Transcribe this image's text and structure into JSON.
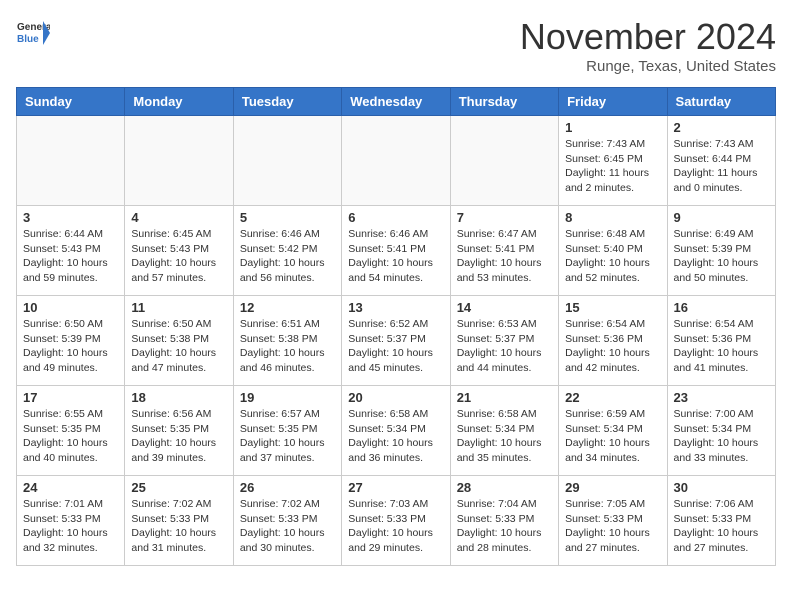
{
  "header": {
    "logo_general": "General",
    "logo_blue": "Blue",
    "month_title": "November 2024",
    "location": "Runge, Texas, United States"
  },
  "days_of_week": [
    "Sunday",
    "Monday",
    "Tuesday",
    "Wednesday",
    "Thursday",
    "Friday",
    "Saturday"
  ],
  "weeks": [
    [
      {
        "day": "",
        "info": ""
      },
      {
        "day": "",
        "info": ""
      },
      {
        "day": "",
        "info": ""
      },
      {
        "day": "",
        "info": ""
      },
      {
        "day": "",
        "info": ""
      },
      {
        "day": "1",
        "info": "Sunrise: 7:43 AM\nSunset: 6:45 PM\nDaylight: 11 hours and 2 minutes."
      },
      {
        "day": "2",
        "info": "Sunrise: 7:43 AM\nSunset: 6:44 PM\nDaylight: 11 hours and 0 minutes."
      }
    ],
    [
      {
        "day": "3",
        "info": "Sunrise: 6:44 AM\nSunset: 5:43 PM\nDaylight: 10 hours and 59 minutes."
      },
      {
        "day": "4",
        "info": "Sunrise: 6:45 AM\nSunset: 5:43 PM\nDaylight: 10 hours and 57 minutes."
      },
      {
        "day": "5",
        "info": "Sunrise: 6:46 AM\nSunset: 5:42 PM\nDaylight: 10 hours and 56 minutes."
      },
      {
        "day": "6",
        "info": "Sunrise: 6:46 AM\nSunset: 5:41 PM\nDaylight: 10 hours and 54 minutes."
      },
      {
        "day": "7",
        "info": "Sunrise: 6:47 AM\nSunset: 5:41 PM\nDaylight: 10 hours and 53 minutes."
      },
      {
        "day": "8",
        "info": "Sunrise: 6:48 AM\nSunset: 5:40 PM\nDaylight: 10 hours and 52 minutes."
      },
      {
        "day": "9",
        "info": "Sunrise: 6:49 AM\nSunset: 5:39 PM\nDaylight: 10 hours and 50 minutes."
      }
    ],
    [
      {
        "day": "10",
        "info": "Sunrise: 6:50 AM\nSunset: 5:39 PM\nDaylight: 10 hours and 49 minutes."
      },
      {
        "day": "11",
        "info": "Sunrise: 6:50 AM\nSunset: 5:38 PM\nDaylight: 10 hours and 47 minutes."
      },
      {
        "day": "12",
        "info": "Sunrise: 6:51 AM\nSunset: 5:38 PM\nDaylight: 10 hours and 46 minutes."
      },
      {
        "day": "13",
        "info": "Sunrise: 6:52 AM\nSunset: 5:37 PM\nDaylight: 10 hours and 45 minutes."
      },
      {
        "day": "14",
        "info": "Sunrise: 6:53 AM\nSunset: 5:37 PM\nDaylight: 10 hours and 44 minutes."
      },
      {
        "day": "15",
        "info": "Sunrise: 6:54 AM\nSunset: 5:36 PM\nDaylight: 10 hours and 42 minutes."
      },
      {
        "day": "16",
        "info": "Sunrise: 6:54 AM\nSunset: 5:36 PM\nDaylight: 10 hours and 41 minutes."
      }
    ],
    [
      {
        "day": "17",
        "info": "Sunrise: 6:55 AM\nSunset: 5:35 PM\nDaylight: 10 hours and 40 minutes."
      },
      {
        "day": "18",
        "info": "Sunrise: 6:56 AM\nSunset: 5:35 PM\nDaylight: 10 hours and 39 minutes."
      },
      {
        "day": "19",
        "info": "Sunrise: 6:57 AM\nSunset: 5:35 PM\nDaylight: 10 hours and 37 minutes."
      },
      {
        "day": "20",
        "info": "Sunrise: 6:58 AM\nSunset: 5:34 PM\nDaylight: 10 hours and 36 minutes."
      },
      {
        "day": "21",
        "info": "Sunrise: 6:58 AM\nSunset: 5:34 PM\nDaylight: 10 hours and 35 minutes."
      },
      {
        "day": "22",
        "info": "Sunrise: 6:59 AM\nSunset: 5:34 PM\nDaylight: 10 hours and 34 minutes."
      },
      {
        "day": "23",
        "info": "Sunrise: 7:00 AM\nSunset: 5:34 PM\nDaylight: 10 hours and 33 minutes."
      }
    ],
    [
      {
        "day": "24",
        "info": "Sunrise: 7:01 AM\nSunset: 5:33 PM\nDaylight: 10 hours and 32 minutes."
      },
      {
        "day": "25",
        "info": "Sunrise: 7:02 AM\nSunset: 5:33 PM\nDaylight: 10 hours and 31 minutes."
      },
      {
        "day": "26",
        "info": "Sunrise: 7:02 AM\nSunset: 5:33 PM\nDaylight: 10 hours and 30 minutes."
      },
      {
        "day": "27",
        "info": "Sunrise: 7:03 AM\nSunset: 5:33 PM\nDaylight: 10 hours and 29 minutes."
      },
      {
        "day": "28",
        "info": "Sunrise: 7:04 AM\nSunset: 5:33 PM\nDaylight: 10 hours and 28 minutes."
      },
      {
        "day": "29",
        "info": "Sunrise: 7:05 AM\nSunset: 5:33 PM\nDaylight: 10 hours and 27 minutes."
      },
      {
        "day": "30",
        "info": "Sunrise: 7:06 AM\nSunset: 5:33 PM\nDaylight: 10 hours and 27 minutes."
      }
    ]
  ]
}
